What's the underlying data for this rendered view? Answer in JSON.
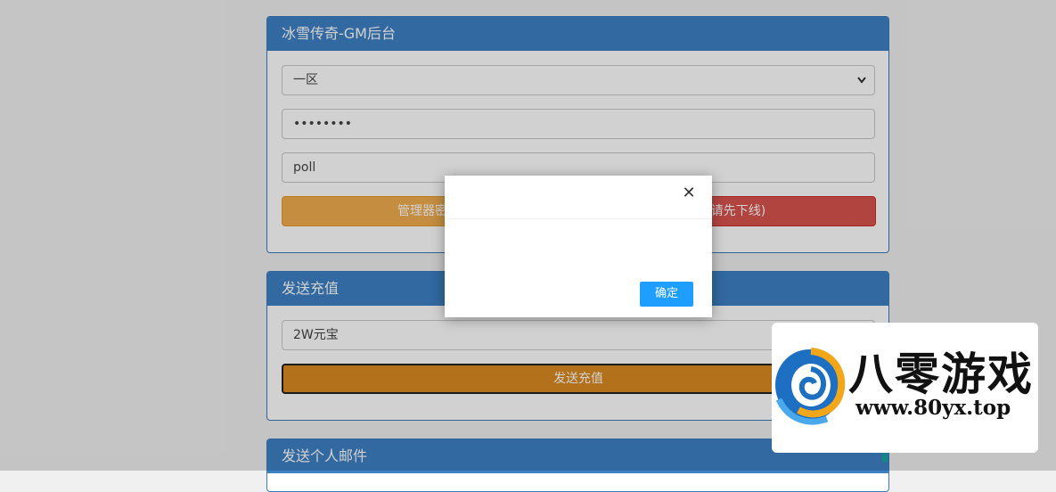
{
  "gm_panel": {
    "title": "冰雪传奇-GM后台",
    "server_select": {
      "value": "一区"
    },
    "password_input": {
      "value": "••••••••"
    },
    "account_input": {
      "value": "poll"
    },
    "left_button_label": "管理器密钥",
    "right_button_label": "件 (请先下线)"
  },
  "recharge_panel": {
    "title": "发送充值",
    "item_select": {
      "value": "2W元宝"
    },
    "send_button_label": "发送充值"
  },
  "mail_panel": {
    "title": "发送个人邮件"
  },
  "dialog": {
    "close_symbol": "✕",
    "confirm_label": "确定"
  },
  "watermark": {
    "brand": "八零游戏",
    "url": "www.80yx.top"
  },
  "colors": {
    "panel_header": "#3c81c4",
    "orange_button": "#f0ad4e",
    "red_button": "#d9534f",
    "dialog_confirm": "#1e9fff"
  }
}
